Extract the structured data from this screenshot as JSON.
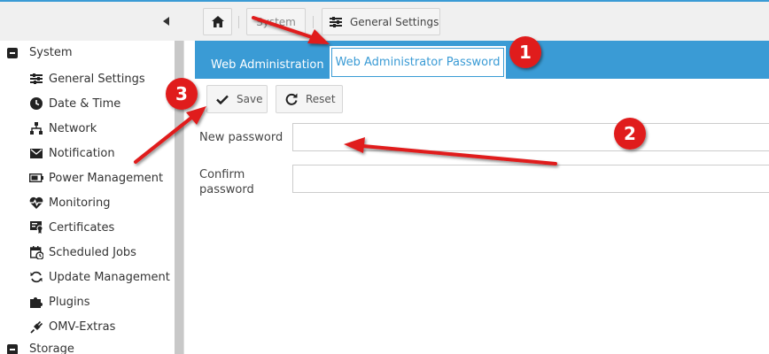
{
  "topbar": {
    "breadcrumb_system": "System",
    "breadcrumb_general": "General Settings"
  },
  "sidebar": {
    "root_system": "System",
    "items": [
      {
        "label": "General Settings",
        "icon": "sliders-icon"
      },
      {
        "label": "Date & Time",
        "icon": "clock-icon"
      },
      {
        "label": "Network",
        "icon": "network-icon"
      },
      {
        "label": "Notification",
        "icon": "envelope-icon"
      },
      {
        "label": "Power Management",
        "icon": "battery-icon"
      },
      {
        "label": "Monitoring",
        "icon": "heart-pulse-icon"
      },
      {
        "label": "Certificates",
        "icon": "certificate-icon"
      },
      {
        "label": "Scheduled Jobs",
        "icon": "calendar-clock-icon"
      },
      {
        "label": "Update Management",
        "icon": "refresh-icon"
      },
      {
        "label": "Plugins",
        "icon": "puzzle-icon"
      },
      {
        "label": "OMV-Extras",
        "icon": "plug-icon"
      }
    ],
    "root_storage": "Storage"
  },
  "tabs": {
    "web_admin": "Web Administration",
    "web_admin_password": "Web Administrator Password"
  },
  "toolbar": {
    "save_label": "Save",
    "reset_label": "Reset"
  },
  "form": {
    "new_password_label": "New password",
    "confirm_password_label_line1": "Confirm",
    "confirm_password_label_line2": "password",
    "new_password_value": "",
    "confirm_password_value": ""
  },
  "annotations": {
    "badge1": "1",
    "badge2": "2",
    "badge3": "3",
    "color": "#e01b1b"
  },
  "colors": {
    "accent": "#3a9bd5"
  }
}
